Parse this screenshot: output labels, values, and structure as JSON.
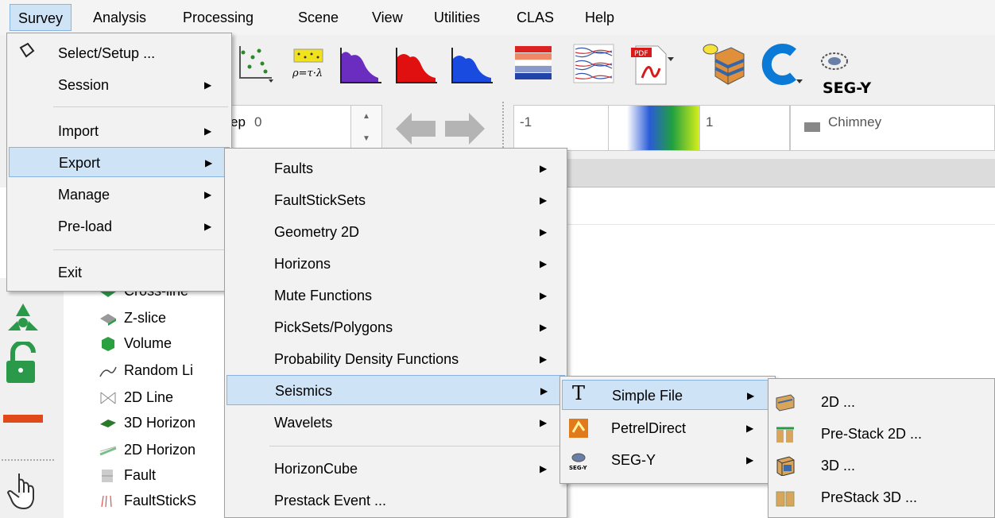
{
  "menubar": {
    "items": [
      "Survey",
      "Analysis",
      "Processing",
      "Scene",
      "View",
      "Utilities",
      "CLAS",
      "Help"
    ]
  },
  "toolbar": {
    "segy_label": "SEG-Y",
    "formula_label": "ρ=τ·λ",
    "pdf_label": "PDF",
    "step_label": "ep",
    "step_value": "0",
    "range_min": "-1",
    "range_max": "1",
    "attribute_label": "Chimney"
  },
  "tree": {
    "items": [
      "Cross-line",
      "Z-slice",
      "Volume",
      "Random Li",
      "2D Line",
      "3D Horizon",
      "2D Horizon",
      "Fault",
      "FaultStickS"
    ]
  },
  "survey_menu": {
    "items": [
      "Select/Setup ...",
      "Session",
      "Import",
      "Export",
      "Manage",
      "Pre-load",
      "Exit"
    ]
  },
  "export_menu": {
    "items": [
      "Faults",
      "FaultStickSets",
      "Geometry 2D",
      "Horizons",
      "Mute Functions",
      "PickSets/Polygons",
      "Probability Density Functions",
      "Seismics",
      "Wavelets",
      "HorizonCube",
      "Prestack Event ..."
    ]
  },
  "seismics_menu": {
    "items": [
      "Simple File",
      "PetrelDirect",
      "SEG-Y"
    ],
    "icon_t": "T",
    "icon_segy": "SEG-Y"
  },
  "simplefile_menu": {
    "items": [
      "2D ...",
      "Pre-Stack 2D ...",
      "3D ...",
      "PreStack 3D ..."
    ]
  }
}
